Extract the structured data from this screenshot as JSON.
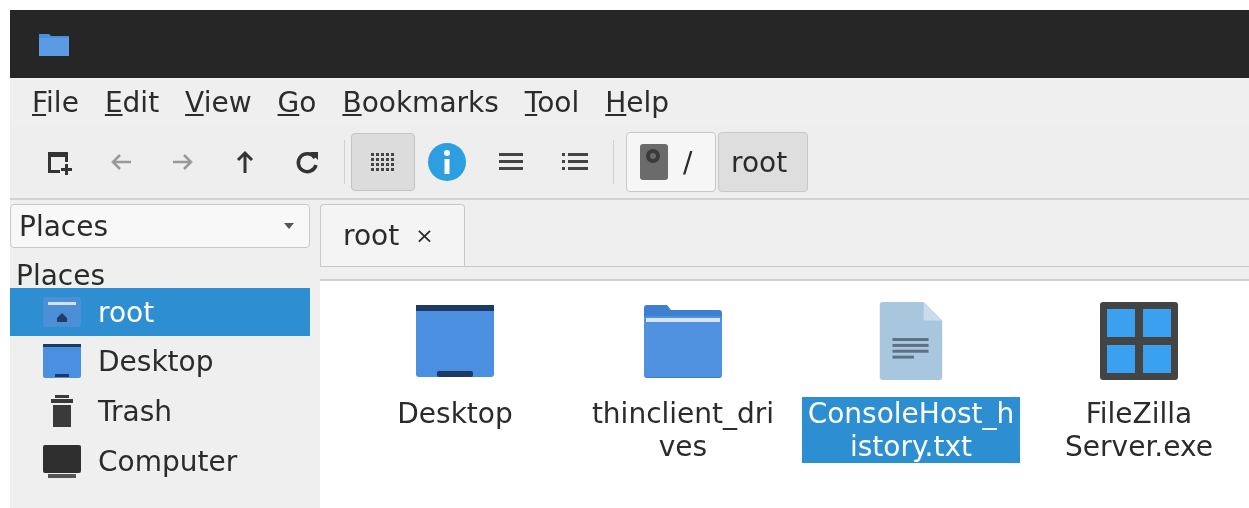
{
  "menu": [
    {
      "label": "File"
    },
    {
      "label": "Edit"
    },
    {
      "label": "View"
    },
    {
      "label": "Go"
    },
    {
      "label": "Bookmarks"
    },
    {
      "label": "Tool"
    },
    {
      "label": "Help"
    }
  ],
  "toolbar": {
    "nav": [
      {
        "kind": "new-window",
        "disabled": false
      },
      {
        "kind": "back",
        "disabled": true
      },
      {
        "kind": "forward",
        "disabled": true
      },
      {
        "kind": "up",
        "disabled": false
      },
      {
        "kind": "reload",
        "disabled": false
      }
    ],
    "views": [
      {
        "kind": "icons",
        "selected": true
      },
      {
        "kind": "info",
        "selected": false
      },
      {
        "kind": "compact",
        "selected": false
      },
      {
        "kind": "details",
        "selected": false
      }
    ],
    "path": [
      {
        "label": "/",
        "kind": "drive",
        "selected": false
      },
      {
        "label": "root",
        "kind": "folder",
        "selected": true
      }
    ]
  },
  "sidebar": {
    "selector": "Places",
    "heading": "Places",
    "items": [
      {
        "label": "root",
        "kind": "home",
        "selected": true
      },
      {
        "label": "Desktop",
        "kind": "desktop",
        "selected": false
      },
      {
        "label": "Trash",
        "kind": "trash",
        "selected": false
      },
      {
        "label": "Computer",
        "kind": "computer",
        "selected": false
      }
    ]
  },
  "tabs": [
    {
      "label": "root",
      "close": "×",
      "selected": true
    }
  ],
  "files": [
    {
      "name": "Desktop",
      "kind": "desktop",
      "selected": false
    },
    {
      "name": "thinclient_drives",
      "kind": "folder",
      "selected": false
    },
    {
      "name": "ConsoleHost_history.txt",
      "kind": "text",
      "selected": true
    },
    {
      "name": "FileZilla Server.exe",
      "kind": "exe",
      "selected": false
    }
  ]
}
